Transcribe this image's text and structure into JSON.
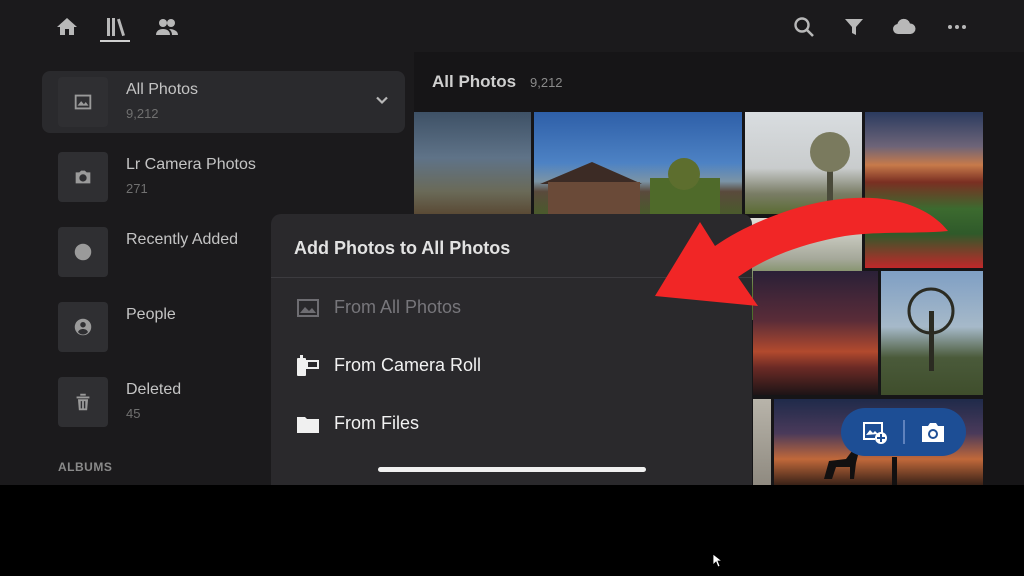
{
  "topbar": {
    "nav_icons": [
      "home-icon",
      "library-icon",
      "people-icon"
    ],
    "action_icons": [
      "search-icon",
      "filter-icon",
      "cloud-icon",
      "more-icon"
    ]
  },
  "sidebar": {
    "items": [
      {
        "name": "All Photos",
        "count": "9,212",
        "icon": "photo-icon",
        "active": true
      },
      {
        "name": "Lr Camera Photos",
        "count": "271",
        "icon": "camera-icon"
      },
      {
        "name": "Recently Added",
        "count": "",
        "icon": "clock-icon"
      },
      {
        "name": "People",
        "count": "",
        "icon": "person-icon"
      },
      {
        "name": "Deleted",
        "count": "45",
        "icon": "trash-icon"
      }
    ],
    "albums_label": "ALBUMS"
  },
  "grid": {
    "title": "All Photos",
    "count": "9,212"
  },
  "sheet": {
    "title": "Add Photos to All Photos",
    "options": [
      {
        "label": "From All Photos",
        "icon": "photo-icon",
        "enabled": false
      },
      {
        "label": "From Camera Roll",
        "icon": "camera-roll-icon",
        "enabled": true
      },
      {
        "label": "From Files",
        "icon": "folder-icon",
        "enabled": true
      }
    ]
  },
  "fab": {
    "buttons": [
      "add-photo-icon",
      "camera-icon"
    ]
  },
  "colors": {
    "background": "#1b1a1c",
    "sheet": "#2a292c",
    "fab": "#1d4e95",
    "annotation_arrow": "#f12626"
  }
}
